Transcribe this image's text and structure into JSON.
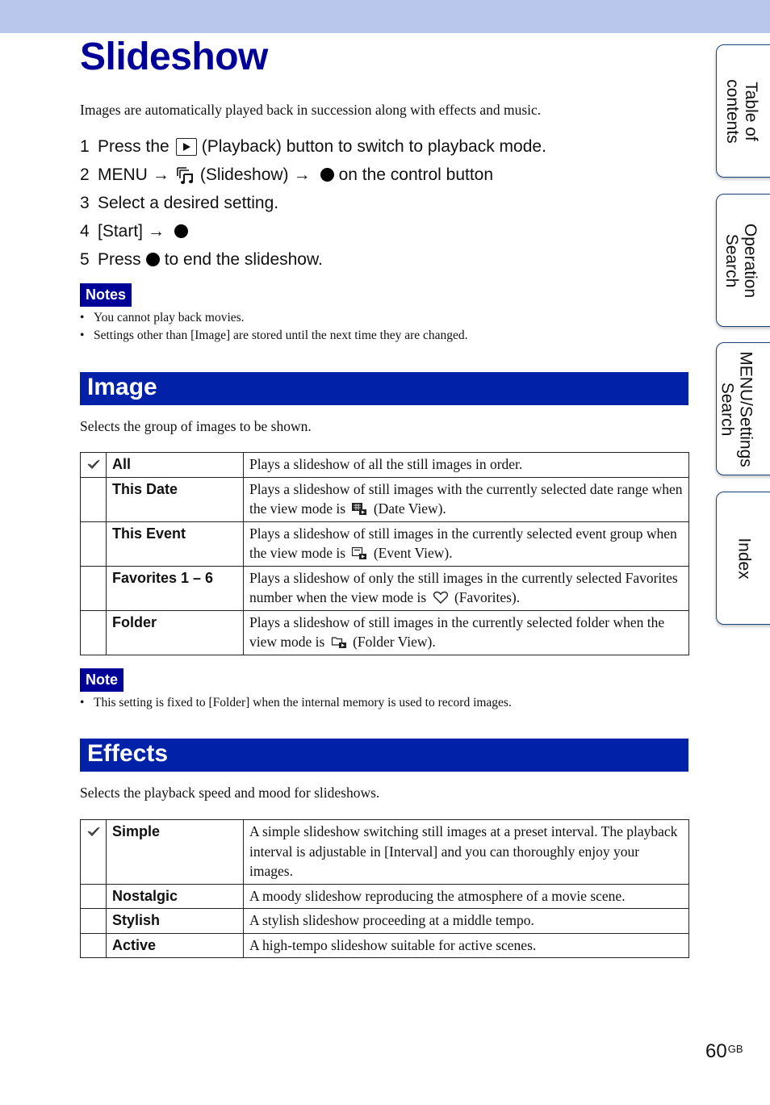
{
  "header": {
    "title": "Slideshow"
  },
  "intro": "Images are automatically played back in succession along with effects and music.",
  "steps": [
    {
      "num": "1",
      "parts": [
        "Press the",
        "playback-icon",
        "(Playback) button to switch to playback mode."
      ],
      "text_a": "Press the",
      "text_b": "(Playback) button to switch to playback mode."
    },
    {
      "num": "2",
      "text_a": "MENU",
      "arrow": "→",
      "text_b": "(Slideshow)",
      "text_c": "on the control button"
    },
    {
      "num": "3",
      "text_a": "Select a desired setting."
    },
    {
      "num": "4",
      "text_a": "[Start]",
      "arrow": "→"
    },
    {
      "num": "5",
      "text_a": "Press",
      "text_b": "to end the slideshow."
    }
  ],
  "notes": {
    "label": "Notes",
    "items": [
      "You cannot play back movies.",
      "Settings other than [Image] are stored until the next time they are changed."
    ]
  },
  "image_section": {
    "heading": "Image",
    "description": "Selects the group of images to be shown.",
    "rows": [
      {
        "name": "All",
        "default": true,
        "desc_a": "Plays a slideshow of all the still images in order."
      },
      {
        "name": "This Date",
        "default": false,
        "desc_a": "Plays a slideshow of still images with the currently selected date range when the view mode is",
        "icon": "date-view-icon",
        "desc_b": "(Date View)."
      },
      {
        "name": "This Event",
        "default": false,
        "desc_a": "Plays a slideshow of still images in the currently selected event group when the view mode is",
        "icon": "event-view-icon",
        "desc_b": "(Event View)."
      },
      {
        "name": "Favorites 1 – 6",
        "default": false,
        "desc_a": "Plays a slideshow of only the still images in the currently selected Favorites number when the view mode is",
        "icon": "favorites-heart-icon",
        "desc_b": "(Favorites)."
      },
      {
        "name": "Folder",
        "default": false,
        "desc_a": "Plays a slideshow of still images in the currently selected folder when the view mode is",
        "icon": "folder-view-icon",
        "desc_b": "(Folder View)."
      }
    ]
  },
  "note": {
    "label": "Note",
    "items": [
      "This setting is fixed to [Folder] when the internal memory is used to record images."
    ]
  },
  "effects_section": {
    "heading": "Effects",
    "description": "Selects the playback speed and mood for slideshows.",
    "rows": [
      {
        "name": "Simple",
        "default": true,
        "desc": "A simple slideshow switching still images at a preset interval. The playback interval is adjustable in [Interval] and you can thoroughly enjoy your images."
      },
      {
        "name": "Nostalgic",
        "default": false,
        "desc": "A moody slideshow reproducing the atmosphere of a movie scene."
      },
      {
        "name": "Stylish",
        "default": false,
        "desc": "A stylish slideshow proceeding at a middle tempo."
      },
      {
        "name": "Active",
        "default": false,
        "desc": "A high-tempo slideshow suitable for active scenes."
      }
    ]
  },
  "side_tabs": [
    {
      "line1": "Table of",
      "line2": "contents"
    },
    {
      "line1": "Operation",
      "line2": "Search"
    },
    {
      "line1": "MENU/Settings",
      "line2": "Search"
    },
    {
      "line1": "Index",
      "line2": ""
    }
  ],
  "footer": {
    "page": "60",
    "suffix": "GB"
  },
  "colors": {
    "title": "#000099",
    "section_bar": "#0021a8",
    "top_bar": "#b8c7eb",
    "note_label": "#000099"
  }
}
